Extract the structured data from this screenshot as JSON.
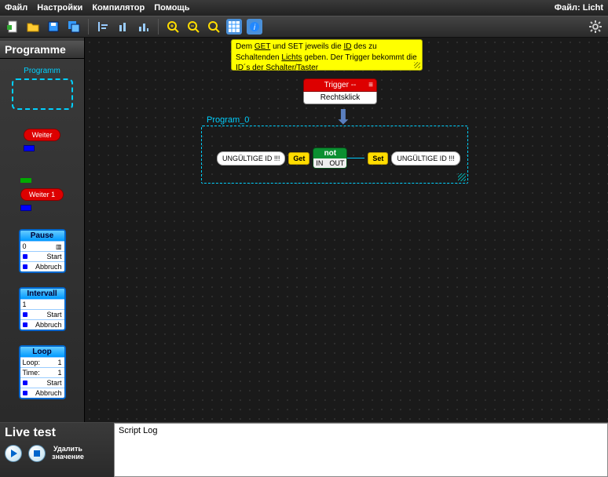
{
  "menu": {
    "items": [
      "Файл",
      "Настройки",
      "Компилятор",
      "Помощь"
    ],
    "file_prefix": "Файл:",
    "file_name": "Licht"
  },
  "toolbar": {
    "icons": [
      "new-file",
      "open-folder",
      "save",
      "save-all",
      "bar1",
      "bar2",
      "bar3",
      "zoom-in",
      "zoom-out",
      "zoom-fit",
      "grid",
      "info"
    ],
    "gear": "settings"
  },
  "sidebar": {
    "title": "Programme",
    "programm_label": "Programm",
    "weiter": "Weiter",
    "weiter1": "Weiter 1",
    "pause": {
      "title": "Pause",
      "value": "0",
      "start": "Start",
      "abbruch": "Abbruch"
    },
    "intervall": {
      "title": "Intervall",
      "value": "1",
      "start": "Start",
      "abbruch": "Abbruch"
    },
    "loop": {
      "title": "Loop",
      "loop_label": "Loop:",
      "loop_val": "1",
      "time_label": "Time:",
      "time_val": "1",
      "start": "Start",
      "abbruch": "Abbruch"
    }
  },
  "canvas": {
    "note_pre": "Dem ",
    "note_get": "GET",
    "note_mid1": " und SET jeweils die ",
    "note_id": "ID",
    "note_mid2": " des zu Schaltenden ",
    "note_lichts": "Lichts",
    "note_post": " geben. Der  Trigger bekommt die ID´s der Schalter/Taster",
    "trigger_title": "Trigger --",
    "trigger_sub": "Rechtsklick",
    "program_title": "Program_0",
    "invalid": "UNGÜLTIGE ID !!!",
    "get": "Get",
    "set": "Set",
    "not": "not",
    "in": "IN",
    "out": "OUT"
  },
  "live": {
    "title": "Live test",
    "delete_l1": "Удалить",
    "delete_l2": "значение",
    "log_title": "Script Log"
  },
  "colors": {
    "accent": "#00d0ff",
    "red": "#d00",
    "green": "#0a7a2a",
    "yellow": "#fd0"
  }
}
